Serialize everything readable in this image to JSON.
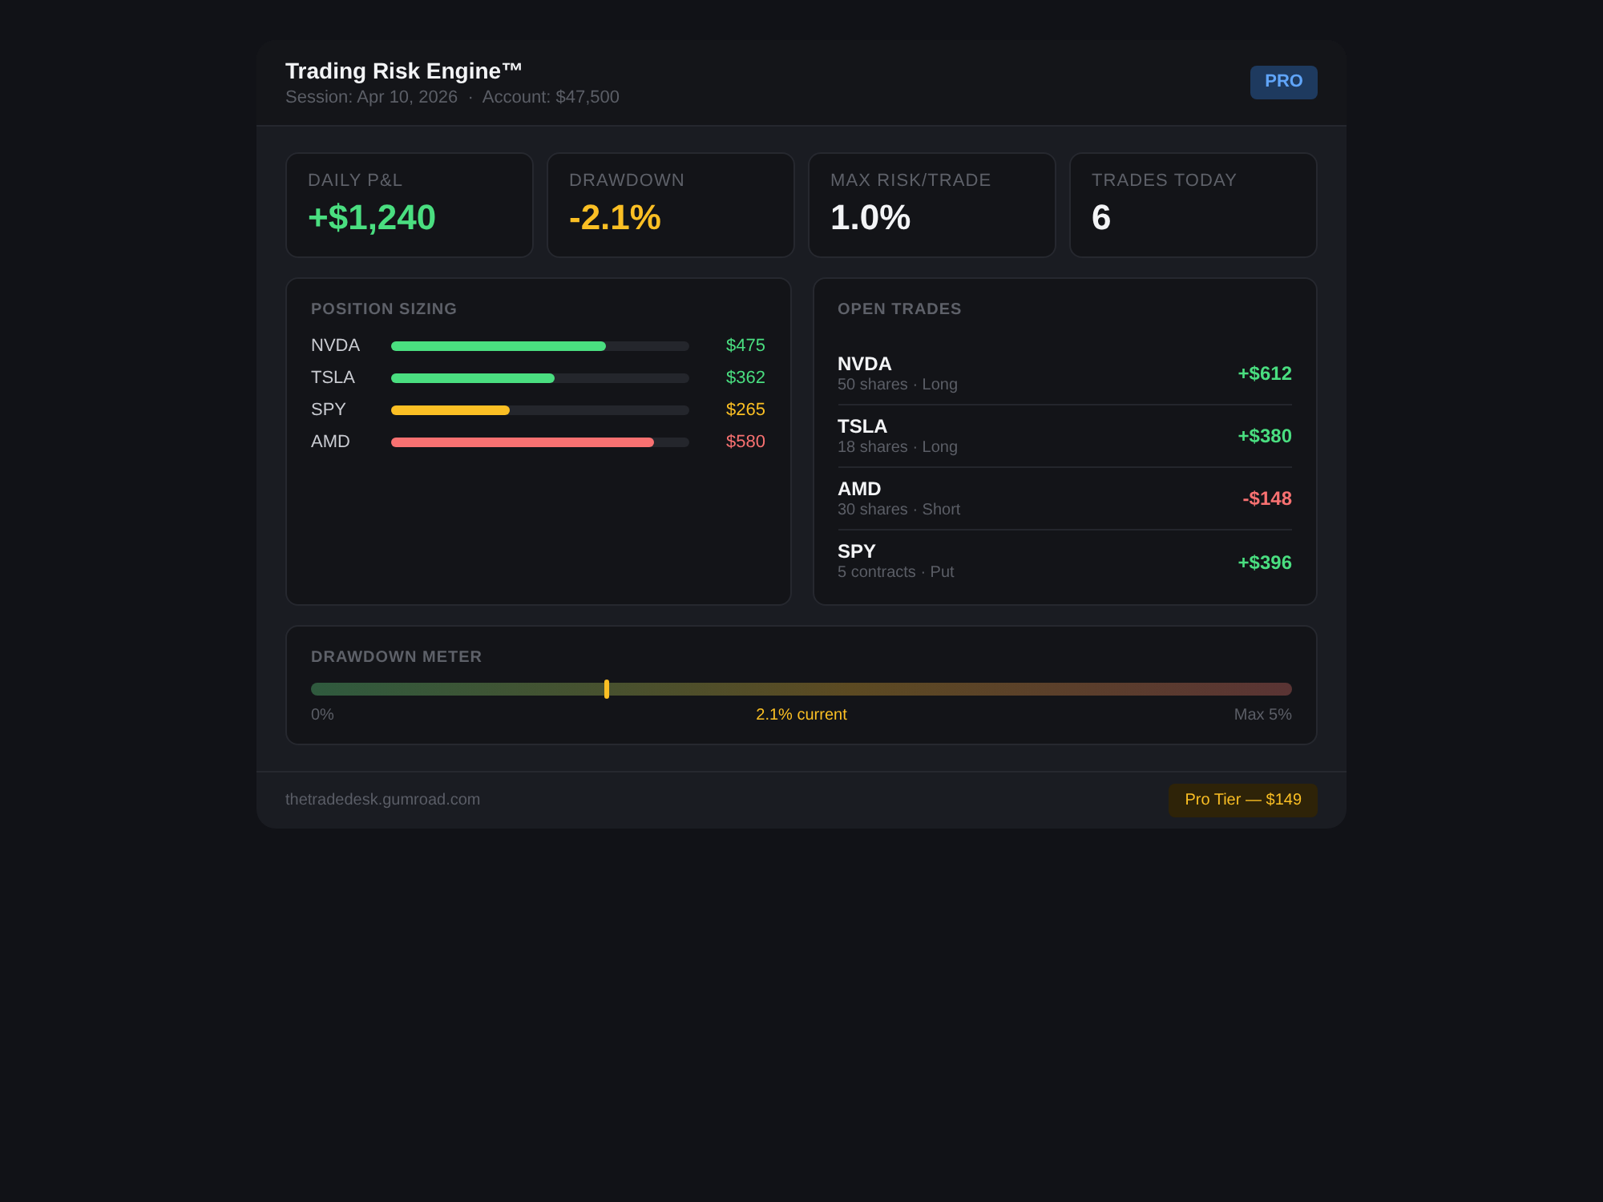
{
  "header": {
    "title": "Trading Risk Engine™",
    "subtitle": "Session: Apr 10, 2026  ·  Account: $47,500",
    "badge": "PRO"
  },
  "stats": [
    {
      "label": "DAILY P&L",
      "value": "+$1,240",
      "color": "#4ade80"
    },
    {
      "label": "DRAWDOWN",
      "value": "-2.1%",
      "color": "#fbbf24"
    },
    {
      "label": "MAX RISK/TRADE",
      "value": "1.0%",
      "color": "#f3f4f6"
    },
    {
      "label": "TRADES TODAY",
      "value": "6",
      "color": "#f3f4f6"
    }
  ],
  "position_sizing": {
    "title": "POSITION SIZING",
    "items": [
      {
        "symbol": "NVDA",
        "level": 0.72,
        "amount": "$475",
        "color": "#4ade80"
      },
      {
        "symbol": "TSLA",
        "level": 0.55,
        "amount": "$362",
        "color": "#4ade80"
      },
      {
        "symbol": "SPY",
        "level": 0.4,
        "amount": "$265",
        "color": "#fbbf24"
      },
      {
        "symbol": "AMD",
        "level": 0.88,
        "amount": "$580",
        "color": "#f87171"
      }
    ]
  },
  "open_trades": {
    "title": "OPEN TRADES",
    "items": [
      {
        "symbol": "NVDA",
        "detail": "50 shares · Long",
        "pnl": "+$612",
        "color": "#4ade80"
      },
      {
        "symbol": "TSLA",
        "detail": "18 shares · Long",
        "pnl": "+$380",
        "color": "#4ade80"
      },
      {
        "symbol": "AMD",
        "detail": "30 shares · Short",
        "pnl": "-$148",
        "color": "#f87171"
      },
      {
        "symbol": "SPY",
        "detail": "5 contracts · Put",
        "pnl": "+$396",
        "color": "#4ade80"
      }
    ]
  },
  "drawdown_meter": {
    "title": "DRAWDOWN METER",
    "level": 0.3,
    "min_label": "0%",
    "current_label": "2.1% current",
    "max_label": "Max 5%"
  },
  "footer": {
    "link": "thetradedesk.gumroad.com",
    "badge": "Pro Tier — $149"
  }
}
